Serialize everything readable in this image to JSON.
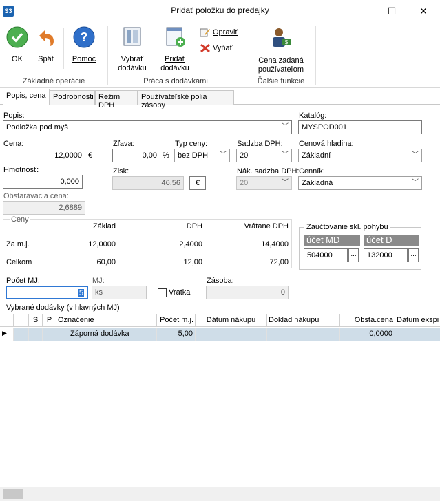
{
  "window": {
    "app_logo": "S3",
    "title": "Pridať položku do predajky",
    "minimize": "—",
    "maximize": "☐",
    "close": "✕"
  },
  "ribbon": {
    "ok": "OK",
    "back": "Späť",
    "help": "Pomoc",
    "group1": "Základné operácie",
    "select_delivery_1": "Vybrať",
    "select_delivery_2": "dodávku",
    "add_delivery_1": "Pridať",
    "add_delivery_2": "dodávku",
    "edit": "Opraviť",
    "remove": "Vyňať",
    "group2": "Práca s dodávkami",
    "user_price_1": "Cena zadaná",
    "user_price_2": "používateľom",
    "group3": "Ďalšie funkcie",
    "colors": {
      "ok": "#4caf50",
      "back": "#e07b2a",
      "help": "#2f6fc9",
      "remove": "#d23a2a"
    }
  },
  "tabs": [
    "Popis, cena",
    "Podrobnosti",
    "Režim DPH",
    "Používateľské polia zásoby"
  ],
  "form": {
    "popis_label": "Popis:",
    "popis_value": "Podložka pod myš",
    "katalog_label": "Katalóg:",
    "katalog_value": "MYSPOD001",
    "cena_label": "Cena:",
    "cena_value": "12,0000",
    "cena_unit": "€",
    "zlava_label": "Zľava:",
    "zlava_value": "0,00",
    "zlava_unit": "%",
    "typ_label": "Typ ceny:",
    "typ_value": "bez DPH",
    "sadzba_label": "Sadzba DPH:",
    "sadzba_value": "20",
    "hladina_label": "Cenová hladina:",
    "hladina_value": "Základní",
    "hmotnost_label": "Hmotnosť:",
    "hmotnost_value": "0,000",
    "zisk_label": "Zisk:",
    "zisk_value": "46,56",
    "zisk_unit": "€",
    "nak_sadzba_label": "Nák. sadzba DPH:",
    "nak_sadzba_value": "20",
    "cennik_label": "Cenník:",
    "cennik_value": "Základná",
    "obst_label": "Obstarávacia cena:",
    "obst_value": "2,6889"
  },
  "ceny": {
    "title": "Ceny",
    "col_zaklad": "Základ",
    "col_dph": "DPH",
    "col_vratane": "Vrátane DPH",
    "row1": {
      "label": "Za m.j.",
      "zaklad": "12,0000",
      "dph": "2,4000",
      "vratane": "14,4000"
    },
    "row2": {
      "label": "Celkom",
      "zaklad": "60,00",
      "dph": "12,00",
      "vratane": "72,00"
    }
  },
  "zauctovanie": {
    "title": "Zaúčtovanie skl. pohybu",
    "md_label": "účet MD",
    "d_label": "účet D",
    "md_value": "504000",
    "d_value": "132000",
    "dots": "..."
  },
  "qty": {
    "pocet_label": "Počet MJ:",
    "pocet_value": "5",
    "mj_label": "MJ:",
    "mj_value": "ks",
    "vratka_label": "Vratka",
    "zasoba_label": "Zásoba:",
    "zasoba_value": "0"
  },
  "grid": {
    "caption": "Vybrané dodávky (v hlavných MJ)",
    "headers": [
      "S",
      "P",
      "Označenie",
      "Počet m.j.",
      "Dátum nákupu",
      "Doklad nákupu",
      "Obsta.cena",
      "Dátum exspi"
    ],
    "rows": [
      {
        "oznacenie": "Záporná dodávka",
        "pocet": "5,00",
        "obst": "0,0000"
      }
    ]
  }
}
